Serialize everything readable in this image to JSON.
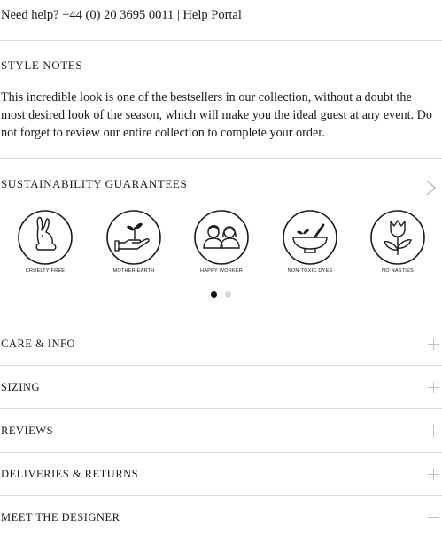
{
  "help_bar": {
    "text": "Need help? +44 (0) 20 3695 0011 | Help Portal"
  },
  "style_notes": {
    "title": "STYLE NOTES",
    "body": "This incredible look is one of the bestsellers in our collection, without a doubt the most desired look of the season, which will make you the ideal guest at any event. Do not forget to review our entire collection to complete your order."
  },
  "sustainability": {
    "title": "SUSTAINABILITY GUARANTEES",
    "next_icon": "chevron-right-icon",
    "badges": [
      {
        "label": "CRUELTY FREE",
        "icon": "rabbit-icon"
      },
      {
        "label": "MOTHER EARTH",
        "icon": "hand-plant-icon"
      },
      {
        "label": "HAPPY WORKER",
        "icon": "workers-icon"
      },
      {
        "label": "NON-TOXIC DYES",
        "icon": "mortar-bowl-icon"
      },
      {
        "label": "NO NASTIES",
        "icon": "tulip-icon"
      }
    ],
    "carousel": {
      "pages": 2,
      "active_page": 1
    }
  },
  "accordion": [
    {
      "label": "CARE & INFO",
      "state": "collapsed"
    },
    {
      "label": "SIZING",
      "state": "collapsed"
    },
    {
      "label": "REVIEWS",
      "state": "collapsed"
    },
    {
      "label": "DELIVERIES & RETURNS",
      "state": "collapsed"
    },
    {
      "label": "MEET THE DESIGNER",
      "state": "expanded"
    }
  ],
  "colors": {
    "text": "#1a1a1a",
    "divider": "#dcdcdc",
    "icon_gray": "#bdbdbd",
    "dot_active": "#111111",
    "dot_inactive": "#d6d6d6"
  }
}
